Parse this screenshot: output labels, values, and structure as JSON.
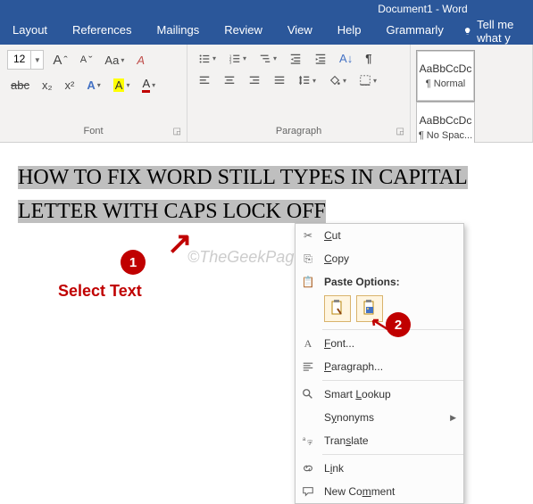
{
  "titlebar": {
    "title": "Document1 - Word"
  },
  "tabs": {
    "items": [
      "Layout",
      "References",
      "Mailings",
      "Review",
      "View",
      "Help",
      "Grammarly"
    ],
    "tell_me": "Tell me what y"
  },
  "ribbon": {
    "font": {
      "label": "Font",
      "size_value": "12",
      "increase": "A",
      "decrease": "A",
      "case": "Aa",
      "clear": "A",
      "strike": "abc",
      "sub": "x₂",
      "sup": "x²",
      "effects": "A",
      "highlight": "A",
      "fontcolor": "A"
    },
    "paragraph": {
      "label": "Paragraph"
    },
    "styles": {
      "normal": {
        "preview": "AaBbCcDc",
        "name": "¶ Normal"
      },
      "nospac": {
        "preview": "AaBbCcDc",
        "name": "¶ No Spac..."
      }
    }
  },
  "document": {
    "selected_text": "HOW TO FIX WORD STILL TYPES IN CAPITAL LETTER WITH CAPS LOCK OFF"
  },
  "annotations": {
    "step1": "1",
    "step1_label": "Select Text",
    "step2": "2"
  },
  "watermark": "©TheGeekPage.com",
  "context_menu": {
    "cut": "Cut",
    "copy": "Copy",
    "paste_heading": "Paste Options:",
    "font": "Font...",
    "paragraph": "Paragraph...",
    "smart_lookup": "Smart Lookup",
    "synonyms": "Synonyms",
    "translate": "Translate",
    "link": "Link",
    "new_comment": "New Comment"
  }
}
